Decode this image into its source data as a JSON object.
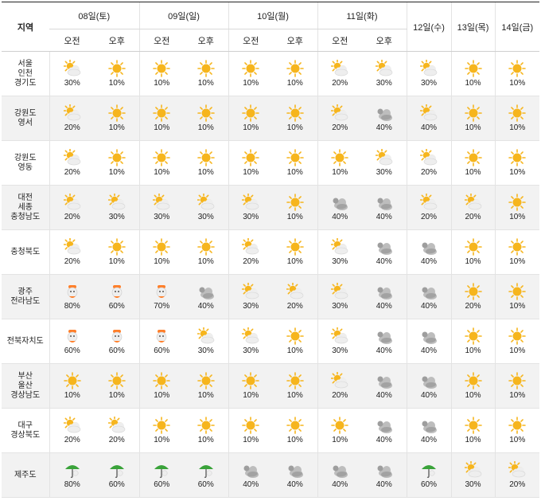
{
  "header": {
    "region_label": "지역",
    "days": [
      {
        "label": "08일(토)",
        "split": true
      },
      {
        "label": "09일(일)",
        "split": true
      },
      {
        "label": "10일(월)",
        "split": true
      },
      {
        "label": "11일(화)",
        "split": true
      },
      {
        "label": "12일(수)",
        "split": false
      },
      {
        "label": "13일(목)",
        "split": false
      },
      {
        "label": "14일(금)",
        "split": false
      }
    ],
    "am": "오전",
    "pm": "오후"
  },
  "colors": {
    "sun": "#f6b51d",
    "cloud": "#bdbdbd",
    "dark_cloud": "#8c8c8c",
    "umbrella": "#3aa33a",
    "rain_drop": "#ff7f2a",
    "row_alt_bg": "#f2f2f2"
  },
  "rows": [
    {
      "region": "서울\n인천\n경기도",
      "cells": [
        {
          "icon": "sun-cloud-icon",
          "pct": "30%"
        },
        {
          "icon": "sun-icon",
          "pct": "10%"
        },
        {
          "icon": "sun-icon",
          "pct": "10%"
        },
        {
          "icon": "sun-icon",
          "pct": "10%"
        },
        {
          "icon": "sun-icon",
          "pct": "10%"
        },
        {
          "icon": "sun-icon",
          "pct": "10%"
        },
        {
          "icon": "sun-cloud-icon",
          "pct": "20%"
        },
        {
          "icon": "sun-cloud-icon",
          "pct": "30%"
        },
        {
          "icon": "sun-cloud-icon",
          "pct": "30%"
        },
        {
          "icon": "sun-icon",
          "pct": "10%"
        },
        {
          "icon": "sun-icon",
          "pct": "10%"
        }
      ]
    },
    {
      "region": "강원도\n영서",
      "cells": [
        {
          "icon": "sun-cloud-icon",
          "pct": "20%"
        },
        {
          "icon": "sun-icon",
          "pct": "10%"
        },
        {
          "icon": "sun-icon",
          "pct": "10%"
        },
        {
          "icon": "sun-icon",
          "pct": "10%"
        },
        {
          "icon": "sun-icon",
          "pct": "10%"
        },
        {
          "icon": "sun-icon",
          "pct": "10%"
        },
        {
          "icon": "sun-cloud-icon",
          "pct": "20%"
        },
        {
          "icon": "cloud-icon",
          "pct": "40%"
        },
        {
          "icon": "sun-cloud-icon",
          "pct": "40%"
        },
        {
          "icon": "sun-icon",
          "pct": "10%"
        },
        {
          "icon": "sun-icon",
          "pct": "10%"
        }
      ]
    },
    {
      "region": "강원도\n영동",
      "cells": [
        {
          "icon": "sun-cloud-icon",
          "pct": "20%"
        },
        {
          "icon": "sun-icon",
          "pct": "10%"
        },
        {
          "icon": "sun-icon",
          "pct": "10%"
        },
        {
          "icon": "sun-icon",
          "pct": "10%"
        },
        {
          "icon": "sun-icon",
          "pct": "10%"
        },
        {
          "icon": "sun-icon",
          "pct": "10%"
        },
        {
          "icon": "sun-icon",
          "pct": "10%"
        },
        {
          "icon": "sun-cloud-icon",
          "pct": "30%"
        },
        {
          "icon": "sun-cloud-icon",
          "pct": "20%"
        },
        {
          "icon": "sun-icon",
          "pct": "10%"
        },
        {
          "icon": "sun-icon",
          "pct": "10%"
        }
      ]
    },
    {
      "region": "대전\n세종\n충청남도",
      "cells": [
        {
          "icon": "sun-cloud-icon",
          "pct": "20%"
        },
        {
          "icon": "sun-cloud-icon",
          "pct": "30%"
        },
        {
          "icon": "sun-cloud-icon",
          "pct": "30%"
        },
        {
          "icon": "sun-cloud-icon",
          "pct": "30%"
        },
        {
          "icon": "sun-cloud-icon",
          "pct": "30%"
        },
        {
          "icon": "sun-icon",
          "pct": "10%"
        },
        {
          "icon": "cloud-icon",
          "pct": "40%"
        },
        {
          "icon": "cloud-icon",
          "pct": "40%"
        },
        {
          "icon": "sun-cloud-icon",
          "pct": "20%"
        },
        {
          "icon": "sun-cloud-icon",
          "pct": "20%"
        },
        {
          "icon": "sun-icon",
          "pct": "10%"
        }
      ]
    },
    {
      "region": "충청북도",
      "cells": [
        {
          "icon": "sun-cloud-icon",
          "pct": "20%"
        },
        {
          "icon": "sun-icon",
          "pct": "10%"
        },
        {
          "icon": "sun-icon",
          "pct": "10%"
        },
        {
          "icon": "sun-icon",
          "pct": "10%"
        },
        {
          "icon": "sun-cloud-icon",
          "pct": "20%"
        },
        {
          "icon": "sun-icon",
          "pct": "10%"
        },
        {
          "icon": "sun-cloud-icon",
          "pct": "30%"
        },
        {
          "icon": "cloud-icon",
          "pct": "40%"
        },
        {
          "icon": "cloud-icon",
          "pct": "40%"
        },
        {
          "icon": "sun-icon",
          "pct": "10%"
        },
        {
          "icon": "sun-icon",
          "pct": "10%"
        }
      ]
    },
    {
      "region": "광주\n전라남도",
      "cells": [
        {
          "icon": "rain-icon",
          "pct": "80%"
        },
        {
          "icon": "rain-icon",
          "pct": "60%"
        },
        {
          "icon": "rain-icon",
          "pct": "70%"
        },
        {
          "icon": "cloud-icon",
          "pct": "40%"
        },
        {
          "icon": "sun-cloud-icon",
          "pct": "30%"
        },
        {
          "icon": "sun-cloud-icon",
          "pct": "20%"
        },
        {
          "icon": "sun-cloud-icon",
          "pct": "30%"
        },
        {
          "icon": "cloud-icon",
          "pct": "40%"
        },
        {
          "icon": "cloud-icon",
          "pct": "40%"
        },
        {
          "icon": "sun-icon",
          "pct": "20%"
        },
        {
          "icon": "sun-icon",
          "pct": "10%"
        }
      ]
    },
    {
      "region": "전북자치도",
      "cells": [
        {
          "icon": "rain-icon",
          "pct": "60%"
        },
        {
          "icon": "rain-icon",
          "pct": "60%"
        },
        {
          "icon": "rain-icon",
          "pct": "60%"
        },
        {
          "icon": "sun-cloud-icon",
          "pct": "30%"
        },
        {
          "icon": "sun-cloud-icon",
          "pct": "30%"
        },
        {
          "icon": "sun-icon",
          "pct": "10%"
        },
        {
          "icon": "sun-cloud-icon",
          "pct": "30%"
        },
        {
          "icon": "cloud-icon",
          "pct": "40%"
        },
        {
          "icon": "cloud-icon",
          "pct": "40%"
        },
        {
          "icon": "sun-icon",
          "pct": "10%"
        },
        {
          "icon": "sun-icon",
          "pct": "10%"
        }
      ]
    },
    {
      "region": "부산\n울산\n경상남도",
      "cells": [
        {
          "icon": "sun-icon",
          "pct": "10%"
        },
        {
          "icon": "sun-icon",
          "pct": "10%"
        },
        {
          "icon": "sun-icon",
          "pct": "10%"
        },
        {
          "icon": "sun-icon",
          "pct": "10%"
        },
        {
          "icon": "sun-icon",
          "pct": "10%"
        },
        {
          "icon": "sun-icon",
          "pct": "10%"
        },
        {
          "icon": "sun-cloud-icon",
          "pct": "20%"
        },
        {
          "icon": "cloud-icon",
          "pct": "40%"
        },
        {
          "icon": "cloud-icon",
          "pct": "40%"
        },
        {
          "icon": "sun-icon",
          "pct": "10%"
        },
        {
          "icon": "sun-icon",
          "pct": "10%"
        }
      ]
    },
    {
      "region": "대구\n경상북도",
      "cells": [
        {
          "icon": "sun-cloud-icon",
          "pct": "20%"
        },
        {
          "icon": "sun-cloud-icon",
          "pct": "20%"
        },
        {
          "icon": "sun-icon",
          "pct": "10%"
        },
        {
          "icon": "sun-icon",
          "pct": "10%"
        },
        {
          "icon": "sun-icon",
          "pct": "10%"
        },
        {
          "icon": "sun-icon",
          "pct": "10%"
        },
        {
          "icon": "sun-icon",
          "pct": "10%"
        },
        {
          "icon": "cloud-icon",
          "pct": "40%"
        },
        {
          "icon": "cloud-icon",
          "pct": "40%"
        },
        {
          "icon": "sun-icon",
          "pct": "10%"
        },
        {
          "icon": "sun-icon",
          "pct": "10%"
        }
      ]
    },
    {
      "region": "제주도",
      "cells": [
        {
          "icon": "umbrella-icon",
          "pct": "80%"
        },
        {
          "icon": "umbrella-icon",
          "pct": "60%"
        },
        {
          "icon": "umbrella-icon",
          "pct": "60%"
        },
        {
          "icon": "umbrella-icon",
          "pct": "60%"
        },
        {
          "icon": "cloud-icon",
          "pct": "40%"
        },
        {
          "icon": "cloud-icon",
          "pct": "40%"
        },
        {
          "icon": "cloud-icon",
          "pct": "40%"
        },
        {
          "icon": "cloud-icon",
          "pct": "40%"
        },
        {
          "icon": "umbrella-icon",
          "pct": "60%"
        },
        {
          "icon": "sun-cloud-icon",
          "pct": "30%"
        },
        {
          "icon": "sun-cloud-icon",
          "pct": "20%"
        }
      ]
    }
  ]
}
